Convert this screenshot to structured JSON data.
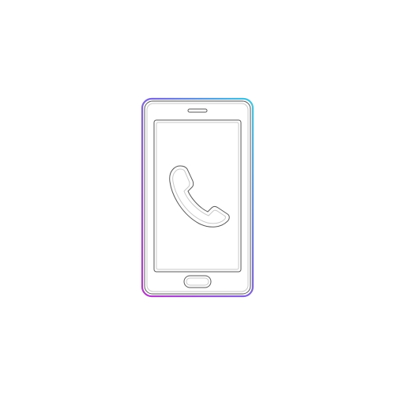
{
  "illustration": {
    "subject": "smartphone-with-phone-call-icon",
    "icons": [
      "smartphone-icon",
      "phone-handset-icon"
    ]
  },
  "colors": {
    "background": "#ffffff",
    "outline_dark": "#5a5a5a",
    "outline_light": "#c8c8c8",
    "gradient_top_right": "#43c6dd",
    "gradient_mid": "#7a6ad8",
    "gradient_bottom_left": "#b23bc4"
  }
}
